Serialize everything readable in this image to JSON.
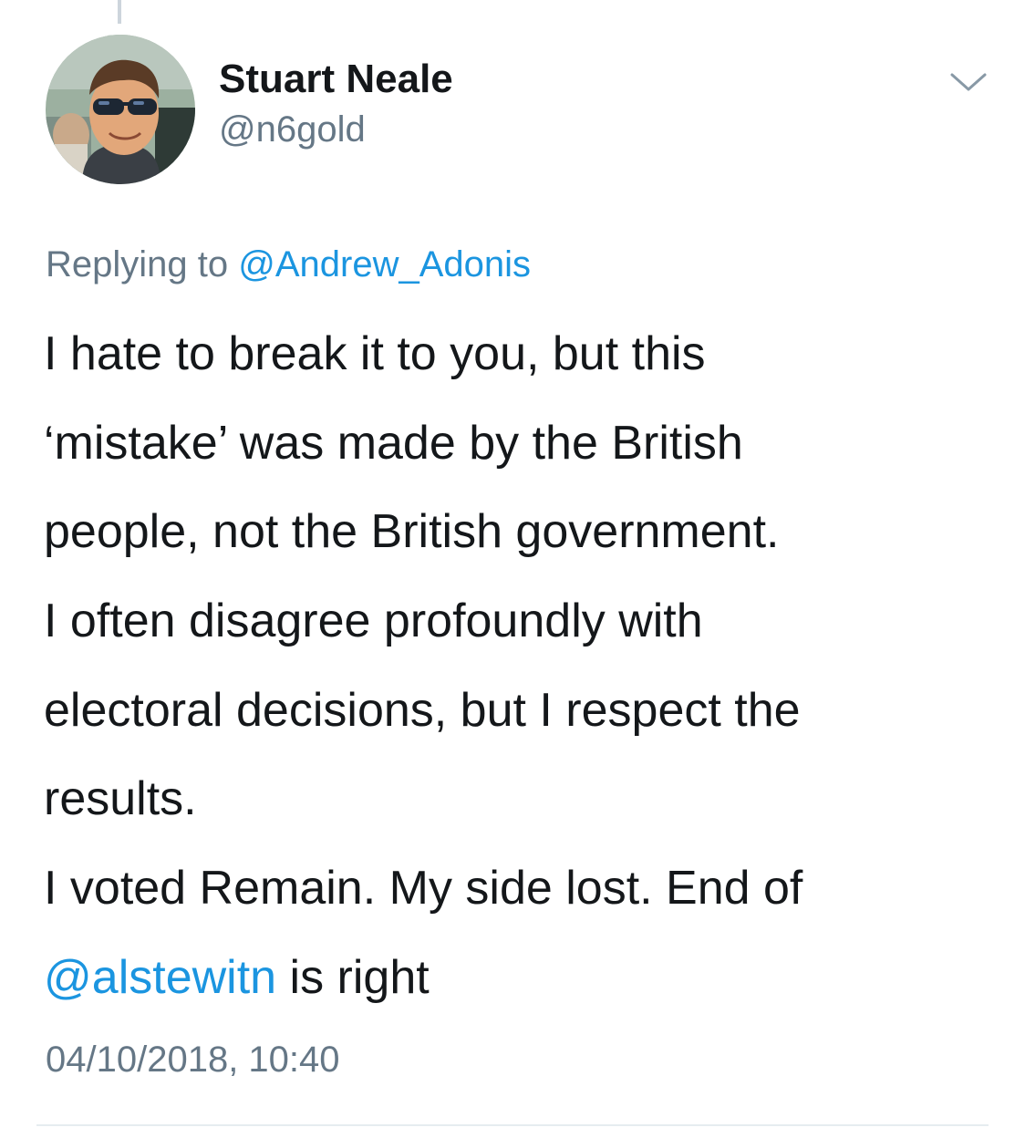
{
  "author": {
    "name": "Stuart Neale",
    "handle": "@n6gold"
  },
  "reply_context": {
    "prefix": "Replying to",
    "mention": "@Andrew_Adonis"
  },
  "tweet": {
    "lines": [
      "I hate to break it to you, but this",
      "‘mistake’ was made by the British",
      "people, not the British government.",
      "I often disagree profoundly with",
      "electoral decisions, but I respect the",
      "results.",
      "I voted Remain. My side lost. End of"
    ],
    "last_line_mention": "@alstewitn",
    "last_line_suffix": " is right"
  },
  "timestamp": "04/10/2018, 10:40",
  "icons": {
    "menu": "chevron-down-icon",
    "avatar": "avatar"
  },
  "colors": {
    "link": "#1b95e0",
    "secondary_text": "#657786",
    "primary_text": "#14171a",
    "divider": "#e6ecf0"
  }
}
